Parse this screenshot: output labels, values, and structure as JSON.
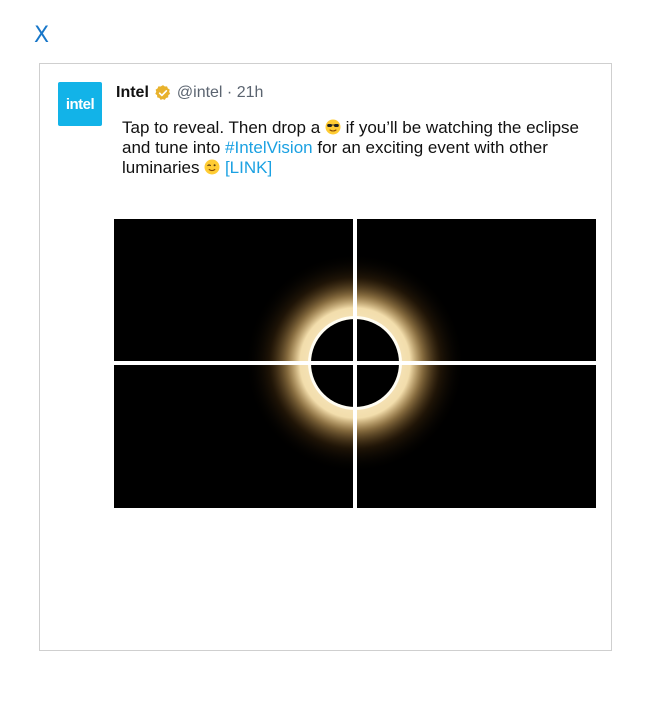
{
  "close": {
    "label": "X"
  },
  "tweet": {
    "avatar_text": "intel",
    "display_name": "Intel",
    "handle": "@intel",
    "separator": " · ",
    "time": "21h",
    "text": {
      "part1": "Tap to reveal. Then drop a ",
      "part2": " if you’ll be watching the eclipse and tune into ",
      "hashtag": "#IntelVision",
      "part3": " for an exciting event with other luminaries ",
      "link": "[LINK]"
    },
    "emojis": [
      "sunglasses-emoji",
      "wink-emoji"
    ],
    "media": {
      "icon": "solar-eclipse-image",
      "grid": "2x2-reveal-tiles"
    }
  },
  "colors": {
    "close": "#1877c9",
    "brand": "#12b3e8",
    "link": "#1ba1e2",
    "verified": "#e8b22c"
  }
}
